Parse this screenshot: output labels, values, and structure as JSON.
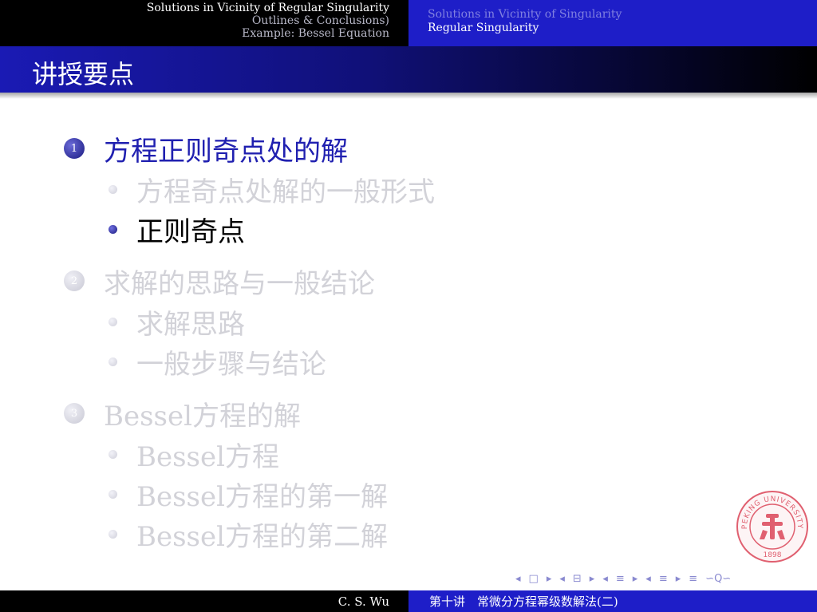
{
  "header": {
    "left": {
      "section1": "Solutions in Vicinity of Regular Singularity",
      "section2": "Outlines & Conclusions)",
      "section3": "Example: Bessel Equation"
    },
    "right": {
      "subsection1": "Solutions in Vicinity of Singularity",
      "subsection2": "Regular Singularity"
    }
  },
  "slide": {
    "title": "讲授要点"
  },
  "outline": [
    {
      "number": "1",
      "label": "方程正则奇点处的解",
      "active": true,
      "items": [
        {
          "label": "方程奇点处解的一般形式",
          "active": false
        },
        {
          "label": "正则奇点",
          "active": true
        }
      ]
    },
    {
      "number": "2",
      "label": "求解的思路与一般结论",
      "active": false,
      "items": [
        {
          "label": "求解思路",
          "active": false
        },
        {
          "label": "一般步骤与结论",
          "active": false
        }
      ]
    },
    {
      "number": "3",
      "label": "Bessel方程的解",
      "active": false,
      "items": [
        {
          "label": "Bessel方程",
          "active": false
        },
        {
          "label": "Bessel方程的第一解",
          "active": false
        },
        {
          "label": "Bessel方程的第二解",
          "active": false
        }
      ]
    }
  ],
  "seal": {
    "text": "PEKING UNIVERSITY",
    "year": "1898",
    "color": "#e06070"
  },
  "nav_icons": {
    "prev_slide": "◂",
    "frame": "□",
    "next_slide": "▸",
    "prev_sub": "◂",
    "sub": "⊟",
    "next_sub": "▸",
    "prev_sec": "◂",
    "sec": "≡",
    "next_sec": "▸",
    "prev_part": "◂",
    "part": "≡",
    "next_part": "▸",
    "toc": "≡",
    "search": "∽Q∽"
  },
  "footer": {
    "author": "C. S. Wu",
    "lecture": "第十讲　常微分方程幂级数解法(二)"
  },
  "colors": {
    "header_blue": "#1e1ec8",
    "active_blue": "#2020b0",
    "inactive_gray": "#d2d2d8"
  }
}
